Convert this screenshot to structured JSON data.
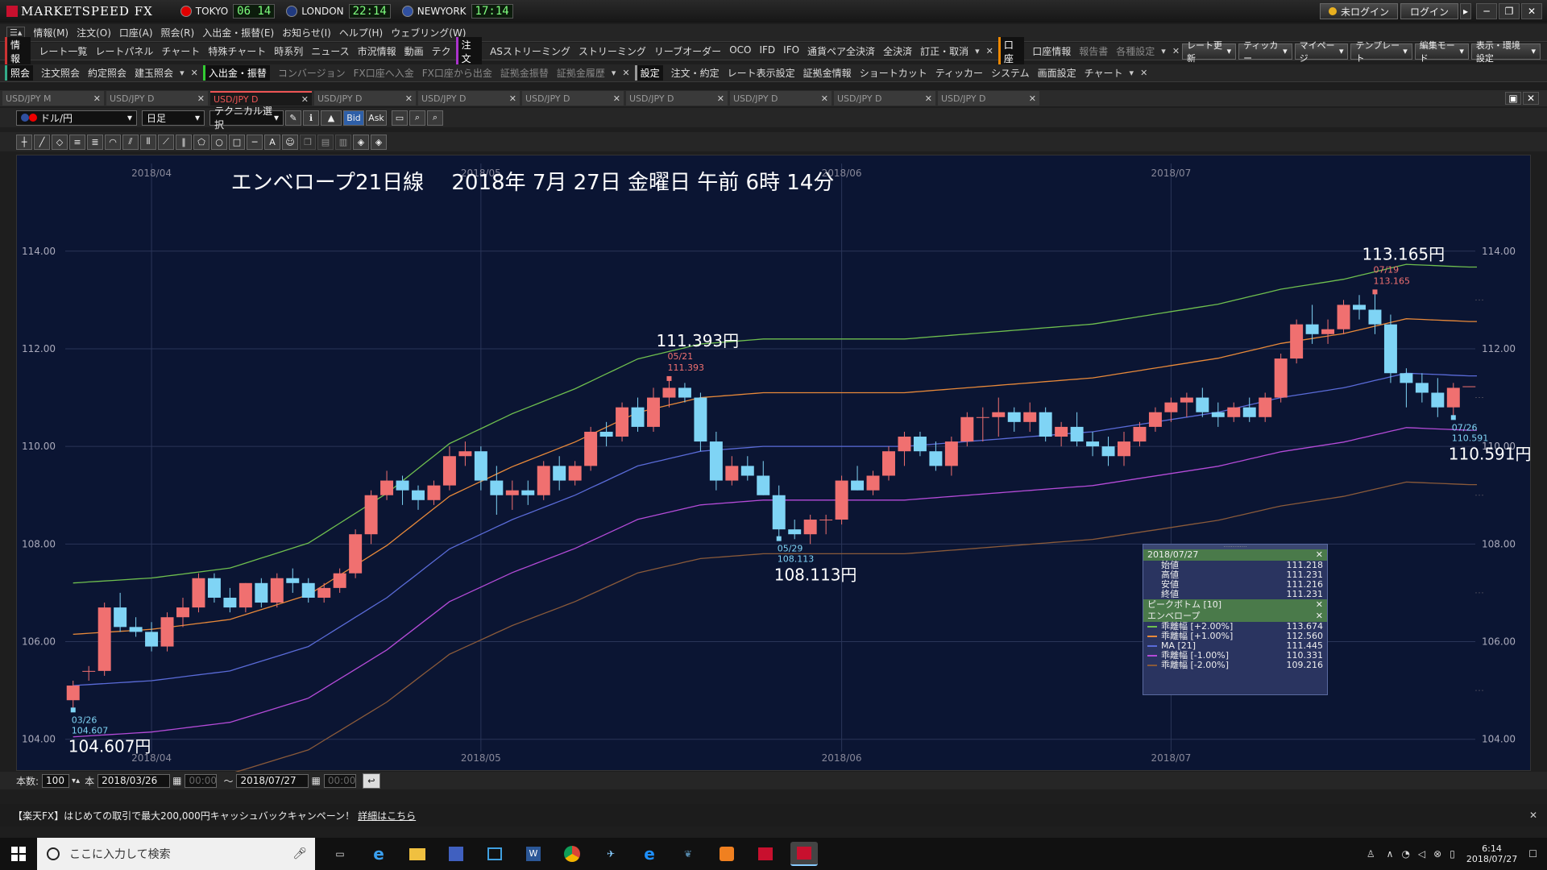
{
  "app": {
    "title": "MARKETSPEED FX"
  },
  "clocks": [
    {
      "city": "TOKYO",
      "time": "06 14",
      "flag": "#e00000"
    },
    {
      "city": "LONDON",
      "time": "22:14",
      "flag": "#203a80"
    },
    {
      "city": "NEWYORK",
      "time": "17:14",
      "flag": "#3050a0"
    }
  ],
  "title_buttons": {
    "login_status": "未ログイン",
    "login": "ログイン"
  },
  "menu": [
    "情報(M)",
    "注文(O)",
    "口座(A)",
    "照会(R)",
    "入出金・振替(E)",
    "お知らせ(I)",
    "ヘルプ(H)",
    "ウェブリング(W)"
  ],
  "toolbar1": {
    "info_group": "情報",
    "info_items": [
      "レート一覧",
      "レートパネル",
      "チャート",
      "特殊チャート",
      "時系列",
      "ニュース",
      "市況情報",
      "動画",
      "テク"
    ],
    "order_group": "注文",
    "order_items": [
      "ASストリーミング",
      "ストリーミング",
      "リーブオーダー",
      "OCO",
      "IFD",
      "IFO",
      "通貨ペア全決済",
      "全決済",
      "訂正・取消"
    ],
    "account_group": "口座",
    "account_items": [
      "口座情報",
      "報告書",
      "各種設定"
    ],
    "right_items": [
      "レート更新",
      "ティッカー",
      "マイページ",
      "テンプレート",
      "編集モード",
      "表示・環境設定"
    ]
  },
  "toolbar2": {
    "inquiry_group": "照会",
    "inquiry_items": [
      "注文照会",
      "約定照会",
      "建玉照会"
    ],
    "deposit_group": "入出金・振替",
    "deposit_items": [
      "コンバージョン",
      "FX口座へ入金",
      "FX口座から出金",
      "証拠金振替",
      "証拠金履歴"
    ],
    "settings_group": "設定",
    "settings_items": [
      "注文・約定",
      "レート表示設定",
      "証拠金情報",
      "ショートカット",
      "ティッカー",
      "システム",
      "画面設定",
      "チャート"
    ]
  },
  "tabs": [
    "USD/JPY M",
    "USD/JPY D",
    "USD/JPY D",
    "USD/JPY D",
    "USD/JPY D",
    "USD/JPY D",
    "USD/JPY D",
    "USD/JPY D",
    "USD/JPY D",
    "USD/JPY D"
  ],
  "active_tab": 2,
  "chart_toolbar": {
    "pair": "ドル/円",
    "period": "日足",
    "technical": "テクニカル選択",
    "bid": "Bid",
    "ask": "Ask"
  },
  "chart_data": {
    "type": "line",
    "title": "エンベロープ21日線　 2018年 7月 27日 金曜日 午前 6時 14分",
    "months": [
      {
        "label": "2018/04",
        "index": 5
      },
      {
        "label": "2018/05",
        "index": 26
      },
      {
        "label": "2018/06",
        "index": 49
      },
      {
        "label": "2018/07",
        "index": 70
      }
    ],
    "ylim": [
      103.5,
      115.3
    ],
    "yticks": [
      104.0,
      106.0,
      108.0,
      110.0,
      112.0,
      114.0
    ],
    "candles": [
      [
        104.8,
        105.2,
        104.6,
        105.1
      ],
      [
        105.4,
        105.5,
        105.2,
        105.4
      ],
      [
        105.4,
        106.8,
        105.3,
        106.7
      ],
      [
        106.7,
        107.0,
        106.2,
        106.3
      ],
      [
        106.3,
        106.5,
        106.1,
        106.2
      ],
      [
        106.2,
        106.4,
        105.8,
        105.9
      ],
      [
        105.9,
        106.6,
        105.8,
        106.5
      ],
      [
        106.5,
        106.9,
        106.3,
        106.7
      ],
      [
        106.7,
        107.4,
        106.6,
        107.3
      ],
      [
        107.3,
        107.4,
        106.8,
        106.9
      ],
      [
        106.9,
        107.1,
        106.6,
        106.7
      ],
      [
        106.7,
        107.2,
        106.6,
        107.2
      ],
      [
        107.2,
        107.3,
        106.7,
        106.8
      ],
      [
        106.8,
        107.4,
        106.7,
        107.3
      ],
      [
        107.3,
        107.5,
        107.0,
        107.2
      ],
      [
        107.2,
        107.3,
        106.8,
        106.9
      ],
      [
        106.9,
        107.2,
        106.8,
        107.1
      ],
      [
        107.1,
        107.5,
        107.0,
        107.4
      ],
      [
        107.4,
        108.3,
        107.3,
        108.2
      ],
      [
        108.2,
        109.1,
        108.0,
        109.0
      ],
      [
        109.0,
        109.5,
        108.9,
        109.3
      ],
      [
        109.3,
        109.4,
        108.8,
        109.1
      ],
      [
        109.1,
        109.2,
        108.7,
        108.9
      ],
      [
        108.9,
        109.3,
        108.8,
        109.2
      ],
      [
        109.2,
        110.0,
        109.1,
        109.8
      ],
      [
        109.8,
        110.1,
        109.6,
        109.9
      ],
      [
        109.9,
        110.0,
        109.1,
        109.3
      ],
      [
        109.3,
        109.6,
        108.6,
        109.0
      ],
      [
        109.0,
        109.3,
        108.7,
        109.1
      ],
      [
        109.1,
        109.3,
        108.8,
        109.0
      ],
      [
        109.0,
        109.7,
        108.9,
        109.6
      ],
      [
        109.6,
        109.8,
        109.1,
        109.3
      ],
      [
        109.3,
        109.7,
        109.2,
        109.6
      ],
      [
        109.6,
        110.4,
        109.5,
        110.3
      ],
      [
        110.3,
        110.5,
        110.0,
        110.2
      ],
      [
        110.2,
        110.9,
        110.1,
        110.8
      ],
      [
        110.8,
        111.0,
        110.3,
        110.4
      ],
      [
        110.4,
        111.2,
        110.3,
        111.0
      ],
      [
        111.0,
        111.39,
        110.8,
        111.2
      ],
      [
        111.2,
        111.3,
        110.9,
        111.0
      ],
      [
        111.0,
        111.1,
        109.9,
        110.1
      ],
      [
        110.1,
        110.3,
        109.1,
        109.3
      ],
      [
        109.3,
        109.8,
        109.2,
        109.6
      ],
      [
        109.6,
        109.8,
        109.3,
        109.4
      ],
      [
        109.4,
        109.7,
        109.0,
        109.0
      ],
      [
        109.0,
        109.2,
        108.11,
        108.3
      ],
      [
        108.3,
        108.5,
        108.1,
        108.2
      ],
      [
        108.2,
        108.6,
        108.0,
        108.5
      ],
      [
        108.5,
        108.6,
        108.2,
        108.5
      ],
      [
        108.5,
        109.4,
        108.4,
        109.3
      ],
      [
        109.3,
        109.6,
        109.1,
        109.1
      ],
      [
        109.1,
        109.5,
        109.0,
        109.4
      ],
      [
        109.4,
        110.0,
        109.3,
        109.9
      ],
      [
        109.9,
        110.3,
        109.6,
        110.2
      ],
      [
        110.2,
        110.3,
        109.8,
        109.9
      ],
      [
        109.9,
        110.1,
        109.5,
        109.6
      ],
      [
        109.6,
        110.2,
        109.4,
        110.1
      ],
      [
        110.1,
        110.7,
        110.0,
        110.6
      ],
      [
        110.6,
        110.8,
        110.1,
        110.6
      ],
      [
        110.6,
        111.0,
        110.2,
        110.7
      ],
      [
        110.7,
        110.8,
        110.3,
        110.5
      ],
      [
        110.5,
        110.9,
        110.3,
        110.7
      ],
      [
        110.7,
        110.8,
        110.1,
        110.2
      ],
      [
        110.2,
        110.5,
        110.0,
        110.4
      ],
      [
        110.4,
        110.7,
        110.0,
        110.1
      ],
      [
        110.1,
        110.3,
        109.8,
        110.0
      ],
      [
        110.0,
        110.2,
        109.6,
        109.8
      ],
      [
        109.8,
        110.3,
        109.6,
        110.1
      ],
      [
        110.1,
        110.5,
        110.0,
        110.4
      ],
      [
        110.4,
        110.8,
        110.3,
        110.7
      ],
      [
        110.7,
        111.0,
        110.5,
        110.9
      ],
      [
        110.9,
        111.1,
        110.6,
        111.0
      ],
      [
        111.0,
        111.2,
        110.6,
        110.7
      ],
      [
        110.7,
        110.9,
        110.4,
        110.6
      ],
      [
        110.6,
        110.9,
        110.5,
        110.8
      ],
      [
        110.8,
        111.0,
        110.5,
        110.6
      ],
      [
        110.6,
        111.1,
        110.5,
        111.0
      ],
      [
        111.0,
        111.9,
        110.9,
        111.8
      ],
      [
        111.8,
        112.6,
        111.7,
        112.5
      ],
      [
        112.5,
        112.9,
        112.1,
        112.3
      ],
      [
        112.3,
        112.6,
        112.1,
        112.4
      ],
      [
        112.4,
        113.0,
        112.3,
        112.9
      ],
      [
        112.9,
        113.1,
        112.6,
        112.8
      ],
      [
        112.8,
        113.165,
        112.3,
        112.5
      ],
      [
        112.5,
        112.7,
        111.3,
        111.5
      ],
      [
        111.5,
        111.6,
        110.8,
        111.3
      ],
      [
        111.3,
        111.5,
        110.9,
        111.1
      ],
      [
        111.1,
        111.4,
        110.6,
        110.8
      ],
      [
        110.8,
        111.3,
        110.591,
        111.2
      ],
      [
        111.218,
        111.231,
        111.216,
        111.231
      ]
    ],
    "envelope_ma": [
      [
        0,
        105.1
      ],
      [
        5,
        105.2
      ],
      [
        10,
        105.4
      ],
      [
        15,
        105.9
      ],
      [
        20,
        106.9
      ],
      [
        24,
        107.9
      ],
      [
        28,
        108.5
      ],
      [
        32,
        109.0
      ],
      [
        36,
        109.6
      ],
      [
        40,
        109.9
      ],
      [
        44,
        110.0
      ],
      [
        48,
        110.0
      ],
      [
        53,
        110.0
      ],
      [
        57,
        110.1
      ],
      [
        61,
        110.2
      ],
      [
        65,
        110.3
      ],
      [
        69,
        110.5
      ],
      [
        73,
        110.7
      ],
      [
        77,
        111.0
      ],
      [
        81,
        111.2
      ],
      [
        85,
        111.5
      ],
      [
        89,
        111.445
      ]
    ],
    "series": [
      {
        "name": "乖離幅 [+2.00%]",
        "pct": 2.0,
        "color": "#6fbf4f",
        "value": "113.674"
      },
      {
        "name": "乖離幅 [+1.00%]",
        "pct": 1.0,
        "color": "#e8893a",
        "value": "112.560"
      },
      {
        "name": "MA [21]",
        "pct": 0.0,
        "color": "#5a6bd8",
        "value": "111.445"
      },
      {
        "name": "乖離幅 [-1.00%]",
        "pct": -1.0,
        "color": "#b44bd8",
        "value": "110.331"
      },
      {
        "name": "乖離幅 [-2.00%]",
        "pct": -2.0,
        "color": "#8a5a3a",
        "value": "109.216"
      }
    ],
    "peaks": [
      {
        "index": 0,
        "kind": "low",
        "date": "03/26",
        "value": "104.607",
        "big": "104.607円"
      },
      {
        "index": 38,
        "kind": "high",
        "date": "05/21",
        "value": "111.393",
        "big": "111.393円"
      },
      {
        "index": 45,
        "kind": "low",
        "date": "05/29",
        "value": "108.113",
        "big": "108.113円"
      },
      {
        "index": 83,
        "kind": "high",
        "date": "07/19",
        "value": "113.165",
        "big": "113.165円"
      },
      {
        "index": 88,
        "kind": "low",
        "date": "07/26",
        "value": "110.591",
        "big": "110.591円"
      }
    ],
    "colors": {
      "up": "#f07070",
      "down": "#7fd4f5",
      "bg": "#0b1533",
      "grid": "#2a3558"
    }
  },
  "info_panel": {
    "date": "2018/07/27",
    "ohlc": [
      {
        "label": "始値",
        "value": "111.218"
      },
      {
        "label": "高値",
        "value": "111.231"
      },
      {
        "label": "安値",
        "value": "111.216"
      },
      {
        "label": "終値",
        "value": "111.231"
      }
    ],
    "peak_bottom": "ピークボトム [10]",
    "envelope": "エンベロープ"
  },
  "bottom": {
    "count_label": "本数:",
    "count": "100",
    "unit": "本",
    "from": "2018/03/26",
    "from_time": "00:00",
    "tilde": "～",
    "to": "2018/07/27",
    "to_time": "00:00"
  },
  "ad": {
    "text": "【楽天FX】はじめての取引で最大200,000円キャッシュバックキャンペーン！",
    "link": "詳細はこちら"
  },
  "taskbar": {
    "search": "ここに入力して検索",
    "time": "6:14",
    "date": "2018/07/27"
  }
}
